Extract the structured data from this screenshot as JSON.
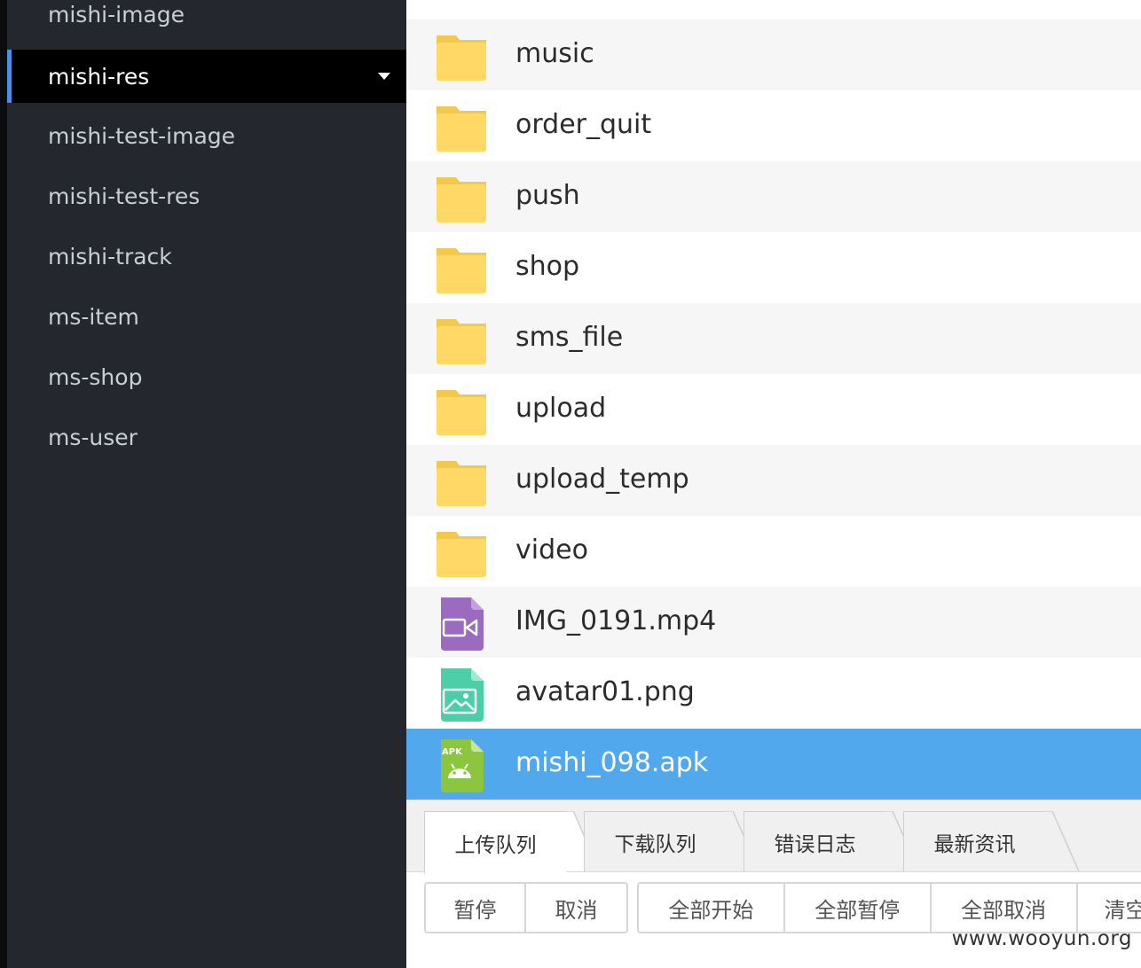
{
  "sidebar": {
    "items": [
      {
        "label": "mishi-image"
      },
      {
        "label": "mishi-res"
      },
      {
        "label": "mishi-test-image"
      },
      {
        "label": "mishi-test-res"
      },
      {
        "label": "mishi-track"
      },
      {
        "label": "ms-item"
      },
      {
        "label": "ms-shop"
      },
      {
        "label": "ms-user"
      }
    ],
    "active_icon": "caret-down-icon"
  },
  "files": [
    {
      "name": "music",
      "icon": "folder-icon"
    },
    {
      "name": "order_quit",
      "icon": "folder-icon"
    },
    {
      "name": "push",
      "icon": "folder-icon"
    },
    {
      "name": "shop",
      "icon": "folder-icon"
    },
    {
      "name": "sms_file",
      "icon": "folder-icon"
    },
    {
      "name": "upload",
      "icon": "folder-icon"
    },
    {
      "name": "upload_temp",
      "icon": "folder-icon"
    },
    {
      "name": "video",
      "icon": "folder-icon"
    },
    {
      "name": "IMG_0191.mp4",
      "icon": "video-file-icon"
    },
    {
      "name": "avatar01.png",
      "icon": "image-file-icon"
    },
    {
      "name": "mishi_098.apk",
      "icon": "apk-file-icon",
      "badge": "APK"
    }
  ],
  "tabs": [
    {
      "label": "上传队列"
    },
    {
      "label": "下载队列"
    },
    {
      "label": "错误日志"
    },
    {
      "label": "最新资讯"
    }
  ],
  "buttons": {
    "group1": [
      "暂停",
      "取消"
    ],
    "group2": [
      "全部开始",
      "全部暂停",
      "全部取消",
      "清空"
    ]
  },
  "watermark": "www.wooyun.org",
  "colors": {
    "sidebar_bg": "#24282e",
    "active_item_bg": "#000000",
    "active_indicator": "#4a90e2",
    "selected_row": "#52a8ec",
    "folder": "#ffd866",
    "video_icon": "#9b6bbf",
    "image_icon": "#4ccfa8",
    "apk_icon": "#8cc63f"
  }
}
